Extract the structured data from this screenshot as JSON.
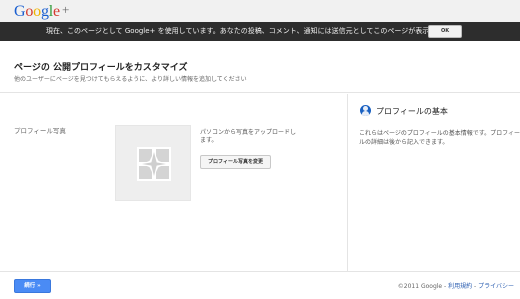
{
  "header": {
    "logo_text": "Google+"
  },
  "notice": {
    "text": "現在、このページとして Google+ を使用しています。あなたの投稿、コメント、通知には送信元としてこのページが表示されます。",
    "ok_label": "OK"
  },
  "title_section": {
    "title": "ページの 公開プロフィールをカスタマイズ",
    "subtitle": "他のユーザーにページを見つけてもらえるように、より詳しい情報を追加してください"
  },
  "main": {
    "photo_label": "プロフィール写真",
    "photo_hint": "パソコンから写真をアップロードします。",
    "change_photo_label": "プロフィール写真を変更"
  },
  "side_panel": {
    "title": "プロフィールの基本",
    "description": "これらはページのプロフィールの基本情報です。プロフィールの詳細は後から記入できます。"
  },
  "footer": {
    "next_label": "続行 »",
    "copyright": "©2011 Google - ",
    "terms_label": "利用規約",
    "separator": " - ",
    "privacy_label": "プライバシー"
  },
  "colors": {
    "accent": "#4a8bf5",
    "notice_bg": "#2d2d2d",
    "topbar_bg": "#f1f1f1",
    "link": "#2a5db0"
  }
}
